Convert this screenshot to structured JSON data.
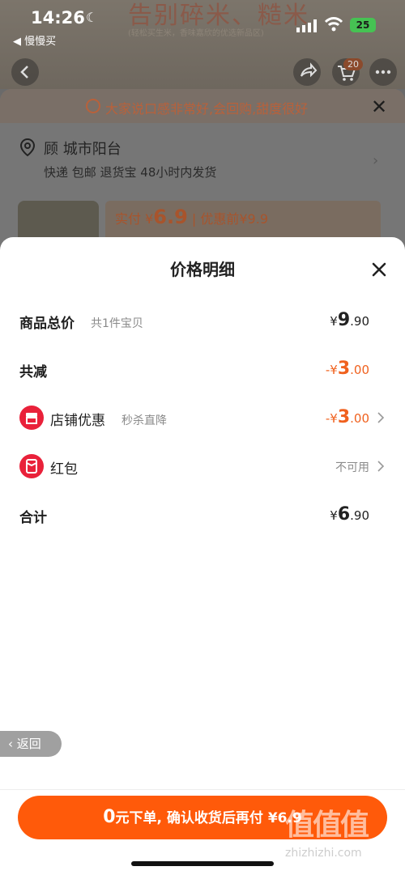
{
  "status": {
    "time": "14:26",
    "back_app": "◀ 慢慢买",
    "battery": "25"
  },
  "background": {
    "banner_title": "告别碎米、糙米",
    "banner_sub": "(轻松买生米，香味嘉欣的优选新品区)",
    "cart_count": "20",
    "notice": "大家说口感非常好,会回购,甜度很好",
    "address": "顾 城市阳台",
    "shipping": "快递 包邮 退货宝 48小时内发货",
    "price_label": "实付 ¥",
    "price_value": "6.9",
    "price_before": "| 优惠前¥9.9"
  },
  "sheet": {
    "title": "价格明细",
    "rows": {
      "total": {
        "label": "商品总价",
        "sub": "共1件宝贝",
        "currency": "¥",
        "int": "9",
        "dec": ".90"
      },
      "reduce": {
        "label": "共减",
        "currency": "-¥",
        "int": "3",
        "dec": ".00"
      },
      "shop": {
        "label": "店铺优惠",
        "sub": "秒杀直降",
        "currency": "-¥",
        "int": "3",
        "dec": ".00"
      },
      "redpacket": {
        "label": "红包",
        "value": "不可用"
      },
      "sum": {
        "label": "合计",
        "currency": "¥",
        "int": "6",
        "dec": ".90"
      }
    },
    "back_label": "返回",
    "cta": {
      "big": "0",
      "text": "元下单, 确认收货后再付 ¥6.9"
    }
  },
  "watermark": {
    "main": "值值值",
    "sub": "zhizhizhi.com"
  },
  "colors": {
    "accent": "#ff5a0a",
    "red_icon": "#e9213a"
  }
}
